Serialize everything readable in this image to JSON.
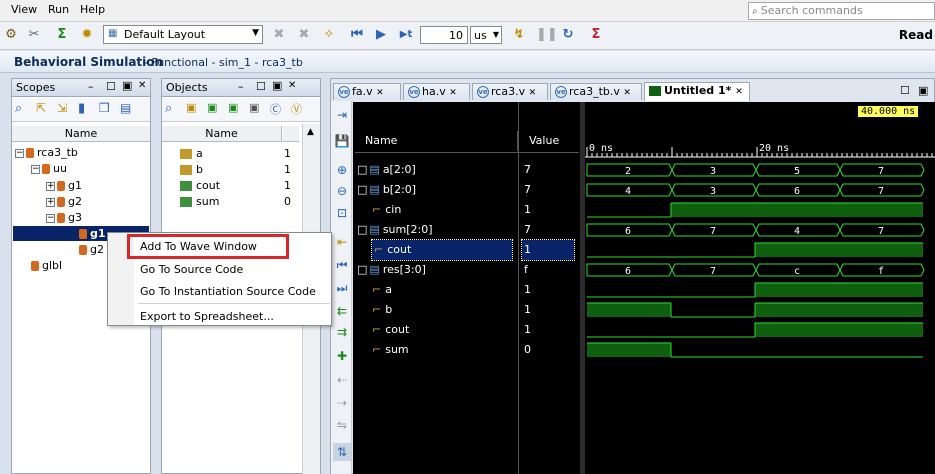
{
  "menubar": {
    "items": [
      "View",
      "Run",
      "Help"
    ],
    "search_placeholder": "Search commands"
  },
  "toolbar": {
    "layout": "Default Layout",
    "time_value": "10",
    "time_unit": "us",
    "status": "Read"
  },
  "sim": {
    "title": "Behavioral Simulation",
    "subtitle": "- Functional - sim_1 - rca3_tb"
  },
  "scopes": {
    "title": "Scopes",
    "column": "Name",
    "tree": [
      "rca3_tb",
      "uu",
      "g1",
      "g2",
      "g3",
      "g1",
      "g2",
      "glbl"
    ]
  },
  "objects": {
    "title": "Objects",
    "col_name": "Name",
    "rows": [
      {
        "name": "a",
        "value": "1"
      },
      {
        "name": "b",
        "value": "1"
      },
      {
        "name": "cout",
        "value": "1"
      },
      {
        "name": "sum",
        "value": "0"
      }
    ]
  },
  "tabs": [
    "fa.v",
    "ha.v",
    "rca3.v",
    "rca3_tb.v",
    "Untitled 1*"
  ],
  "wave": {
    "col_name": "Name",
    "col_value": "Value",
    "cursor_time": "40.000 ns",
    "time_labels": [
      "0 ns",
      "20 ns"
    ],
    "signals": [
      {
        "name": "a[2:0]",
        "value": "7",
        "segs": [
          "2",
          "3",
          "5",
          "7"
        ]
      },
      {
        "name": "b[2:0]",
        "value": "7",
        "segs": [
          "4",
          "3",
          "6",
          "7"
        ]
      },
      {
        "name": "cin",
        "value": "1"
      },
      {
        "name": "sum[2:0]",
        "value": "7",
        "segs": [
          "6",
          "7",
          "4",
          "7"
        ]
      },
      {
        "name": "cout",
        "value": "1"
      },
      {
        "name": "res[3:0]",
        "value": "f",
        "segs": [
          "6",
          "7",
          "c",
          "f"
        ]
      },
      {
        "name": "a",
        "value": "1"
      },
      {
        "name": "b",
        "value": "1"
      },
      {
        "name": "cout",
        "value": "1"
      },
      {
        "name": "sum",
        "value": "0"
      }
    ]
  },
  "context_menu": [
    "Add To Wave Window",
    "Go To Source Code",
    "Go To Instantiation Source Code",
    "Export to Spreadsheet..."
  ],
  "colors": {
    "highlight": "#d9262b",
    "wave_green": "#0e5f0e",
    "wave_line": "#2fdd2f"
  }
}
